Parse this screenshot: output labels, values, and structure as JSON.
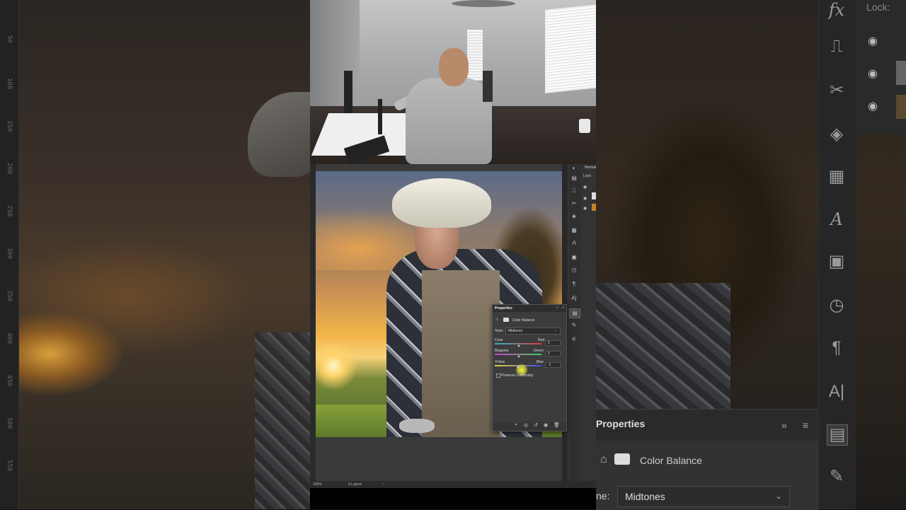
{
  "background_left": {
    "ruler_labels": [
      "50",
      "100",
      "150",
      "200",
      "250",
      "300",
      "350",
      "400",
      "450",
      "500",
      "550"
    ]
  },
  "background_right": {
    "lock_label": "Lock:",
    "panel_title": "Properties",
    "adjustment_name": "Color Balance",
    "tone_label": "ne:",
    "tone_value": "Midtones",
    "tools": [
      "fx-icon",
      "stamp-icon",
      "scissors-icon",
      "paint-bucket-icon",
      "adjustments-icon",
      "type-icon",
      "notes-icon",
      "history-icon",
      "paragraph-icon",
      "character-icon"
    ]
  },
  "photoshop": {
    "layers_blend": "Normal",
    "layers_lock": "Lock:",
    "status_zoom": "100%",
    "status_layers": "3 Layers",
    "properties": {
      "title": "Properties",
      "adjustment": "Color Balance",
      "tone_label": "Tone:",
      "tone_value": "Midtones",
      "sliders": [
        {
          "left": "Cyan",
          "right": "Red",
          "value": "0",
          "position": 0.5
        },
        {
          "left": "Magenta",
          "right": "Green",
          "value": "0",
          "position": 0.5
        },
        {
          "left": "Yellow",
          "right": "Blue",
          "value": "-1",
          "position": 0.49
        }
      ],
      "preserve_luminosity_label": "Preserve Luminosity",
      "preserve_luminosity_checked": false
    }
  },
  "colors": {
    "accent_cursor": "#d6d63a",
    "panel_bg": "#3c3c3c"
  }
}
